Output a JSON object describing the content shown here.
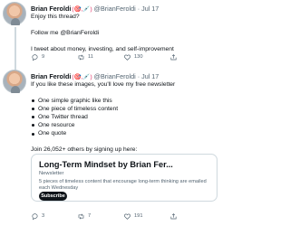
{
  "colors": {
    "text": "#0f1419",
    "muted": "#536471",
    "border": "#cfd9de",
    "accent_badge": "#e0245e"
  },
  "tweets": [
    {
      "author": "Brian Feroldi",
      "badges": "(🎯,💉)",
      "handle": "@BrianFeroldi",
      "separator": "·",
      "date": "Jul 17",
      "paragraphs": [
        "Enjoy this thread?",
        "Follow me @BrianFeroldi",
        "I tweet about money, investing, and self-improvement"
      ],
      "actions": {
        "replies": "9",
        "retweets": "11",
        "likes": "130"
      }
    },
    {
      "author": "Brian Feroldi",
      "badges": "(🎯,💉)",
      "handle": "@BrianFeroldi",
      "separator": "·",
      "date": "Jul 17",
      "intro": "If you like these images, you'll love my free newsletter",
      "list": [
        "One simple graphic like this",
        "One piece of timeless content",
        "One Twitter thread",
        "One resource",
        "One quote"
      ],
      "join_text": "Join 26,052+ others by signing up here:",
      "card": {
        "title": "Long-Term Mindset by Brian Fer...",
        "subtitle": "Newsletter",
        "description": "5 pieces of timeless content that encourage long-term thinking are emailed each Wednesday",
        "button": "Subscribe"
      },
      "actions": {
        "replies": "3",
        "retweets": "7",
        "likes": "191"
      }
    }
  ]
}
